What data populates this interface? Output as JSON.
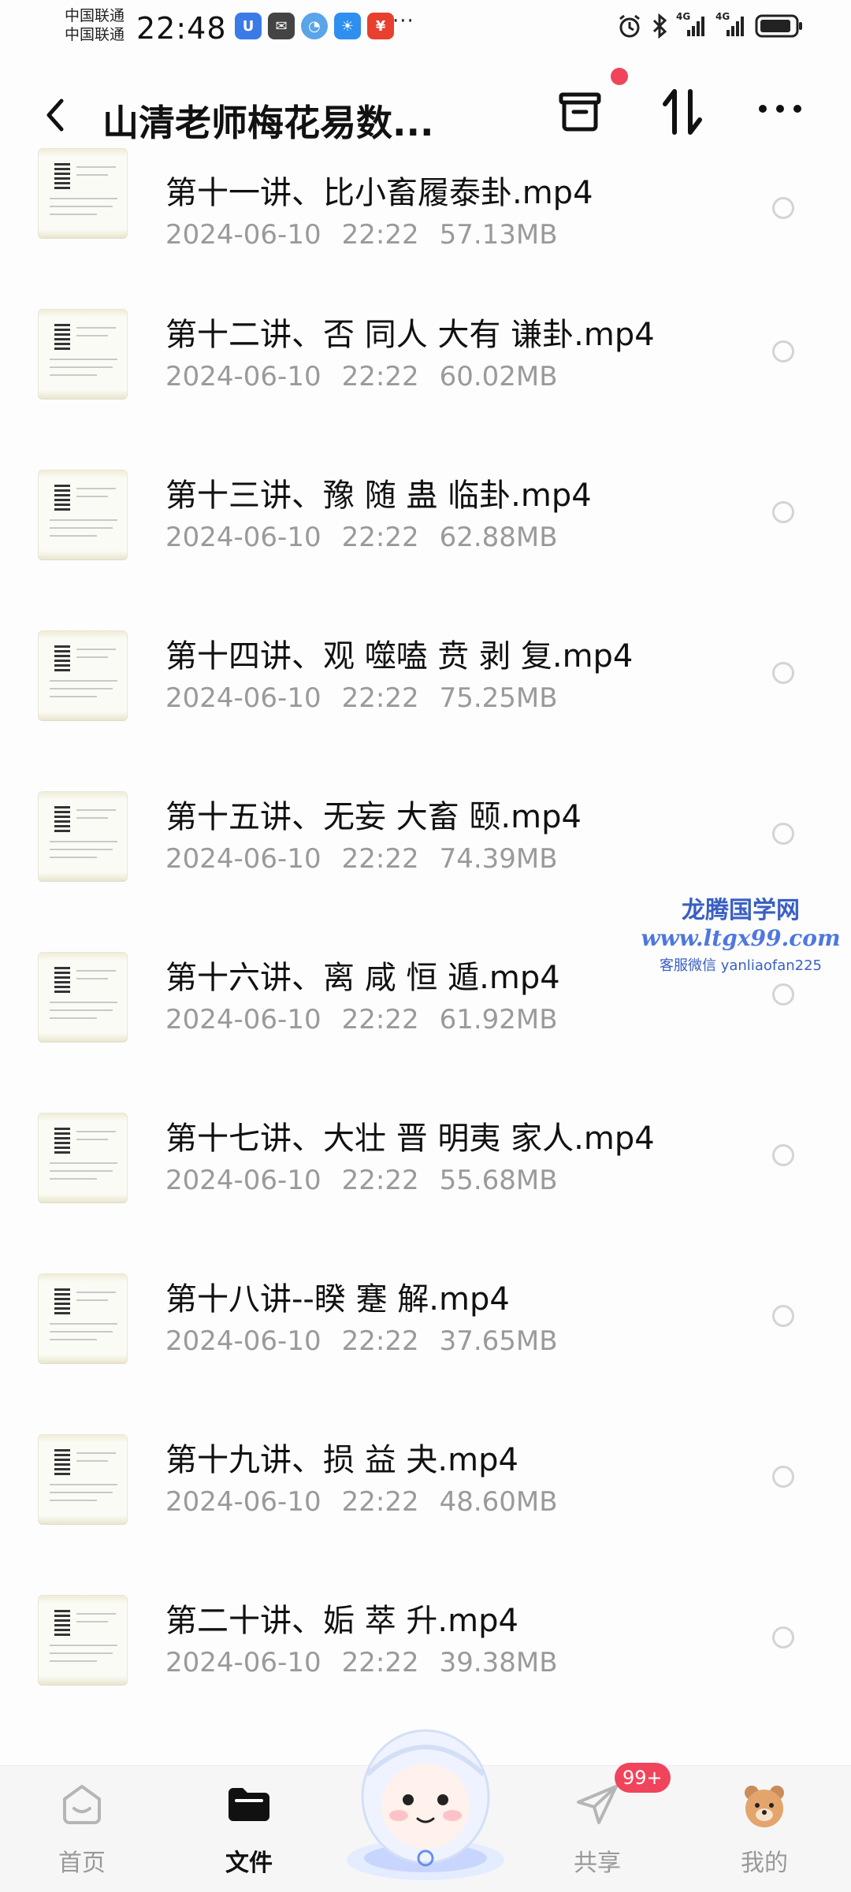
{
  "status_bar": {
    "carrier_1": "中国联通",
    "carrier_2": "中国联通",
    "time": "22:48",
    "more": "···",
    "signal_1": "4G",
    "signal_2": "4G"
  },
  "header": {
    "title": "山清老师梅花易数..."
  },
  "files": [
    {
      "name": "第十一讲、比小畜履泰卦.mp4",
      "date": "2024-06-10",
      "time": "22:22",
      "size": "57.13MB"
    },
    {
      "name": "第十二讲、否 同人 大有 谦卦.mp4",
      "date": "2024-06-10",
      "time": "22:22",
      "size": "60.02MB"
    },
    {
      "name": "第十三讲、豫 随 蛊 临卦.mp4",
      "date": "2024-06-10",
      "time": "22:22",
      "size": "62.88MB"
    },
    {
      "name": "第十四讲、观 噬嗑 贲 剥 复.mp4",
      "date": "2024-06-10",
      "time": "22:22",
      "size": "75.25MB"
    },
    {
      "name": "第十五讲、无妄 大畜 颐.mp4",
      "date": "2024-06-10",
      "time": "22:22",
      "size": "74.39MB"
    },
    {
      "name": "第十六讲、离 咸 恒 遁.mp4",
      "date": "2024-06-10",
      "time": "22:22",
      "size": "61.92MB"
    },
    {
      "name": "第十七讲、大壮 晋 明夷 家人.mp4",
      "date": "2024-06-10",
      "time": "22:22",
      "size": "55.68MB"
    },
    {
      "name": "第十八讲--睽 蹇 解.mp4",
      "date": "2024-06-10",
      "time": "22:22",
      "size": "37.65MB"
    },
    {
      "name": "第十九讲、损 益 夬.mp4",
      "date": "2024-06-10",
      "time": "22:22",
      "size": "48.60MB"
    },
    {
      "name": "第二十讲、姤 萃 升.mp4",
      "date": "2024-06-10",
      "time": "22:22",
      "size": "39.38MB"
    }
  ],
  "watermark": {
    "line1": "龙腾国学网",
    "line2": "www.ltgx99.com",
    "line3": "客服微信 yanliaofan225"
  },
  "bottom_nav": {
    "home": "首页",
    "files": "文件",
    "share": "共享",
    "share_badge": "99+",
    "me": "我的"
  },
  "colors": {
    "accent": "#f0445c",
    "meta_text": "#9a9a9a",
    "watermark": "#3a5fc4"
  }
}
